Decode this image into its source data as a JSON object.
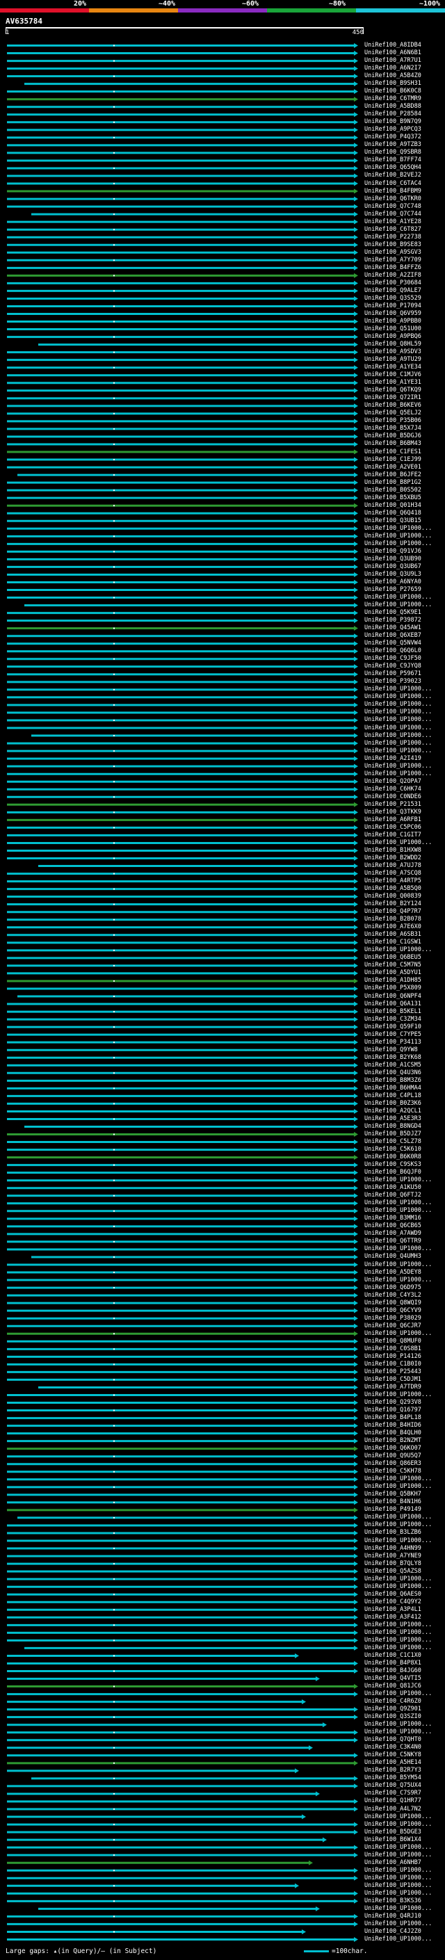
{
  "legend": {
    "labels": [
      "20%",
      "~40%",
      "~60%",
      "~80%",
      "~100%"
    ],
    "colors": [
      "#e0112a",
      "#e88612",
      "#8a2bc1",
      "#1aa53a",
      "#1ec4d8"
    ]
  },
  "query": {
    "title": "AV635784",
    "scale_start": "1",
    "scale_end": "450"
  },
  "hit_colors": {
    "cyan": "#00c0cf",
    "green": "#2e9a32"
  },
  "hits": [
    "UniRef100_A8IDB4",
    "UniRef100_A6N6B1",
    "UniRef100_A7R7U1",
    "UniRef100_A6N2I7",
    "UniRef100_A5B4Z0",
    "UniRef100_B9SH31",
    "UniRef100_B6K0C8",
    "UniRef100_C6TMR9",
    "UniRef100_A5BD88",
    "UniRef100_P28584",
    "UniRef100_B9N7Q9",
    "UniRef100_A9PCQ3",
    "UniRef100_P4Q372",
    "UniRef100_A9TZB3",
    "UniRef100_Q9SBR8",
    "UniRef100_B7FF74",
    "UniRef100_Q65QH4",
    "UniRef100_B2VEJ2",
    "UniRef100_C6TAC4",
    "UniRef100_B4FBM9",
    "UniRef100_Q6TKR0",
    "UniRef100_Q7C748",
    "UniRef100_Q7C744",
    "UniRef100_A1YE28",
    "UniRef100_C6T827",
    "UniRef100_P22738",
    "UniRef100_B9SE83",
    "UniRef100_A9SGV3",
    "UniRef100_A7Y709",
    "UniRef100_B4FFZ6",
    "UniRef100_A2ZIF8",
    "UniRef100_P30684",
    "UniRef100_Q9ALE7",
    "UniRef100_Q3S529",
    "UniRef100_P17094",
    "UniRef100_Q6V959",
    "UniRef100_A9PBB0",
    "UniRef100_Q51U00",
    "UniRef100_A9PBQ6",
    "UniRef100_Q8HL59",
    "UniRef100_A9SDV3",
    "UniRef100_A9TU29",
    "UniRef100_A1YE34",
    "UniRef100_C1MJV6",
    "UniRef100_A1YE31",
    "UniRef100_Q6TKQ9",
    "UniRef100_Q72IR1",
    "UniRef100_B6KEV6",
    "UniRef100_Q5ELJ2",
    "UniRef100_P35B06",
    "UniRef100_B5X7J4",
    "UniRef100_B5DGJ6",
    "UniRef100_B6BM43",
    "UniRef100_C1FES1",
    "UniRef100_C1EJ99",
    "UniRef100_A2VE01",
    "UniRef100_B6JFE2",
    "UniRef100_B8P1G2",
    "UniRef100_B0S502",
    "UniRef100_B5XBU5",
    "UniRef100_Q01H34",
    "UniRef100_Q6Q418",
    "UniRef100_Q3UB15",
    "UniRef100_UP1000...",
    "UniRef100_UP1000...",
    "UniRef100_UP1000...",
    "UniRef100_Q91VJ6",
    "UniRef100_Q3UB90",
    "UniRef100_Q3UB67",
    "UniRef100_Q3U9L3",
    "UniRef100_A6NYA0",
    "UniRef100_P27659",
    "UniRef100_UP1000...",
    "UniRef100_UP1000...",
    "UniRef100_Q5K9E1",
    "UniRef100_P39872",
    "UniRef100_Q45AW1",
    "UniRef100_Q6XEB7",
    "UniRef100_Q5NVW4",
    "UniRef100_Q6Q6L0",
    "UniRef100_C9JF50",
    "UniRef100_C9JYQ8",
    "UniRef100_P59671",
    "UniRef100_P39023",
    "UniRef100_UP1000...",
    "UniRef100_UP1000...",
    "UniRef100_UP1000...",
    "UniRef100_UP1000...",
    "UniRef100_UP1000...",
    "UniRef100_UP1000...",
    "UniRef100_UP1000...",
    "UniRef100_UP1000...",
    "UniRef100_UP1000...",
    "UniRef100_A2I419",
    "UniRef100_UP1000...",
    "UniRef100_UP1000...",
    "UniRef100_Q2OPA7",
    "UniRef100_C6HK74",
    "UniRef100_C0NDE6",
    "UniRef100_P21531",
    "UniRef100_Q3TKK9",
    "UniRef100_A6RFB1",
    "UniRef100_C5PC06",
    "UniRef100_C1GIT7",
    "UniRef100_UP1000...",
    "UniRef100_B1HXW8",
    "UniRef100_B2WDD2",
    "UniRef100_A7UJ78",
    "UniRef100_A7SCQ8",
    "UniRef100_A4RTP5",
    "UniRef100_A5B5Q0",
    "UniRef100_Q00839",
    "UniRef100_B2Y124",
    "UniRef100_Q4P7R7",
    "UniRef100_B2B078",
    "UniRef100_A7E6X0",
    "UniRef100_A6SB31",
    "UniRef100_C1GSW1",
    "UniRef100_UP1000...",
    "UniRef100_Q6BEU5",
    "UniRef100_C5M7N5",
    "UniRef100_A5DYU1",
    "UniRef100_A1DH85",
    "UniRef100_P5X809",
    "UniRef100_Q6NPF4",
    "UniRef100_Q6A131",
    "UniRef100_B5KEL1",
    "UniRef100_C3ZM34",
    "UniRef100_Q59F10",
    "UniRef100_C7YPE5",
    "UniRef100_P34113",
    "UniRef100_Q9YW8",
    "UniRef100_B2YK68",
    "UniRef100_A1CSM5",
    "UniRef100_Q4U3N6",
    "UniRef100_B8M3Z6",
    "UniRef100_B6HMA4",
    "UniRef100_C4PL18",
    "UniRef100_B0Z3K6",
    "UniRef100_A2QCL1",
    "UniRef100_A5E3R3",
    "UniRef100_B8NGD4",
    "UniRef100_B5DJZ7",
    "UniRef100_C5LZ78",
    "UniRef100_C5K610",
    "UniRef100_B6K0R8",
    "UniRef100_C9SKS3",
    "UniRef100_B6QJF0",
    "UniRef100_UP1000...",
    "UniRef100_A1KU50",
    "UniRef100_Q6FTJ2",
    "UniRef100_UP1000...",
    "UniRef100_UP1000...",
    "UniRef100_B3MM16",
    "UniRef100_Q6CB65",
    "UniRef100_A7AWD9",
    "UniRef100_Q6TTR9",
    "UniRef100_UP1000...",
    "UniRef100_Q4UMH3",
    "UniRef100_UP1000...",
    "UniRef100_A5DEY8",
    "UniRef100_UP1000...",
    "UniRef100_Q6D975",
    "UniRef100_C4Y3L2",
    "UniRef100_Q8WQI9",
    "UniRef100_Q6CYV9",
    "UniRef100_P38029",
    "UniRef100_Q6CJR7",
    "UniRef100_UP1000...",
    "UniRef100_Q8MUF0",
    "UniRef100_C0S8B1",
    "UniRef100_P14126",
    "UniRef100_C1B0I0",
    "UniRef100_P25443",
    "UniRef100_C5DJM1",
    "UniRef100_A7TDR9",
    "UniRef100_UP1000...",
    "UniRef100_Q293V8",
    "UniRef100_Q16797",
    "UniRef100_B4PL18",
    "UniRef100_B4HID6",
    "UniRef100_B4QLH0",
    "UniRef100_B2NZMT",
    "UniRef100_Q6KO07",
    "UniRef100_Q9U5Q7",
    "UniRef100_Q86ER3",
    "UniRef100_C5KH78",
    "UniRef100_UP1000...",
    "UniRef100_UP1000...",
    "UniRef100_Q5BKH7",
    "UniRef100_B4N1H6",
    "UniRef100_P49149",
    "UniRef100_UP1000...",
    "UniRef100_UP1000...",
    "UniRef100_B3LZB6",
    "UniRef100_UP1000...",
    "UniRef100_A4HN99",
    "UniRef100_A7YNE9",
    "UniRef100_B7QLY8",
    "UniRef100_Q5AZS8",
    "UniRef100_UP1000...",
    "UniRef100_UP1000...",
    "UniRef100_Q6AES0",
    "UniRef100_C4Q9Y2",
    "UniRef100_A3P4L1",
    "UniRef100_A3F412",
    "UniRef100_UP1000...",
    "UniRef100_UP1000...",
    "UniRef100_UP1000...",
    "UniRef100_UP1000...",
    "UniRef100_C1C1X0",
    "UniRef100_B4P8X1",
    "UniRef100_B4JG60",
    "UniRef100_Q4VTI5",
    "UniRef100_Q81JC6",
    "UniRef100_UP1000...",
    "UniRef100_C4R6Z0",
    "UniRef100_Q9Z901",
    "UniRef100_Q3SZI0",
    "UniRef100_UP1000...",
    "UniRef100_UP1000...",
    "UniRef100_Q7QHT0",
    "UniRef100_C3K4N0",
    "UniRef100_C5NKY8",
    "UniRef100_A5HE14",
    "UniRef100_B2R7Y3",
    "UniRef100_B5YM54",
    "UniRef100_Q75UX4",
    "UniRef100_C7S9R7",
    "UniRef100_Q1HR77",
    "UniRef100_A4L7N2",
    "UniRef100_UP1000...",
    "UniRef100_UP1000...",
    "UniRef100_B5DGE3",
    "UniRef100_B6W1X4",
    "UniRef100_UP1000...",
    "UniRef100_UP1000...",
    "UniRef100_A6NHB7",
    "UniRef100_UP1000...",
    "UniRef100_UP1000...",
    "UniRef100_UP1000...",
    "UniRef100_UP1000...",
    "UniRef100_B3KS36",
    "UniRef100_UP1000...",
    "UniRef100_Q4RJ10",
    "UniRef100_UP1000...",
    "UniRef100_C4J2Z0",
    "UniRef100_UP1000..."
  ],
  "footer": {
    "left": "Large gaps: ▴(in Query)/– (in Subject)",
    "right": "=100char."
  }
}
